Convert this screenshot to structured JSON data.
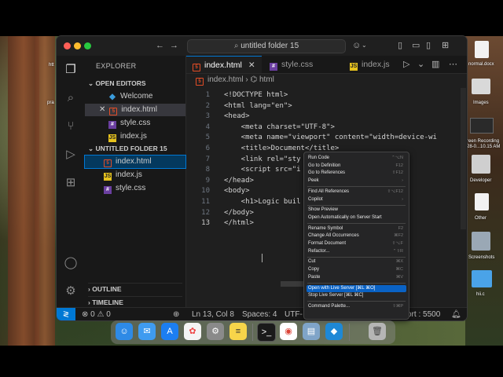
{
  "window": {
    "command_center": "untitled folder 15"
  },
  "sidebar": {
    "title": "EXPLORER",
    "open_editors_label": "OPEN EDITORS",
    "open_editors": [
      {
        "label": "Welcome",
        "icon": "vscode-icon"
      },
      {
        "label": "index.html",
        "icon": "html-file-icon"
      },
      {
        "label": "style.css",
        "icon": "css-file-icon"
      },
      {
        "label": "index.js",
        "icon": "js-file-icon"
      }
    ],
    "folder_label": "UNTITLED FOLDER 15",
    "files": [
      {
        "label": "index.html",
        "icon": "html-file-icon"
      },
      {
        "label": "index.js",
        "icon": "js-file-icon"
      },
      {
        "label": "style.css",
        "icon": "css-file-icon"
      }
    ],
    "outline_label": "OUTLINE",
    "timeline_label": "TIMELINE"
  },
  "tabs": [
    {
      "label": "index.html"
    },
    {
      "label": "style.css"
    },
    {
      "label": "index.js"
    }
  ],
  "breadcrumb": {
    "file": "index.html",
    "node": "html"
  },
  "editor": {
    "current_line": 13,
    "line_numbers": [
      "1",
      "2",
      "3",
      "4",
      "5",
      "6",
      "7",
      "8",
      "9",
      "10",
      "11",
      "12",
      "13"
    ],
    "lines": [
      "<!DOCTYPE html>",
      "<html lang=\"en\">",
      "<head>",
      "    <meta charset=\"UTF-8\">",
      "    <meta name=\"viewport\" content=\"width=device-wi",
      "    <title>Document</title>",
      "    <link rel=\"sty",
      "    <script src=\"i",
      "</head>",
      "<body>",
      "    <h1>Logic buil",
      "</body>",
      "</html>"
    ]
  },
  "context_menu": {
    "items": [
      {
        "label": "Run Code",
        "shortcut": "⌃⌥N"
      },
      {
        "label": "Go to Definition",
        "shortcut": "F12"
      },
      {
        "label": "Go to References",
        "shortcut": "⇧F12"
      },
      {
        "label": "Peek",
        "shortcut": "›"
      },
      {
        "label": "Find All References",
        "shortcut": "⇧⌥F12"
      },
      {
        "label": "Copilot",
        "shortcut": "›"
      },
      {
        "label": "Show Preview",
        "shortcut": ""
      },
      {
        "label": "Open Automatically on Server Start",
        "shortcut": ""
      },
      {
        "label": "Rename Symbol",
        "shortcut": "F2"
      },
      {
        "label": "Change All Occurrences",
        "shortcut": "⌘F2"
      },
      {
        "label": "Format Document",
        "shortcut": "⇧⌥F"
      },
      {
        "label": "Refactor...",
        "shortcut": "⌃⇧R"
      },
      {
        "label": "Cut",
        "shortcut": "⌘X"
      },
      {
        "label": "Copy",
        "shortcut": "⌘C"
      },
      {
        "label": "Paste",
        "shortcut": "⌘V"
      },
      {
        "label": "Open with Live Server [⌘L ⌘O]",
        "shortcut": ""
      },
      {
        "label": "Stop Live Server [⌘L ⌘C]",
        "shortcut": ""
      },
      {
        "label": "Command Palette...",
        "shortcut": "⇧⌘P"
      }
    ]
  },
  "statusbar": {
    "errors": "0",
    "warnings": "0",
    "position": "Ln 13, Col 8",
    "spaces": "Spaces: 4",
    "encoding": "UTF-",
    "port": "ort : 5500"
  },
  "desktop": {
    "labels": [
      "normal.docx",
      "Images",
      "reen Recording",
      "28-0...10.15 AM",
      "Developer",
      "Other",
      "Screenshots",
      "hii.c"
    ],
    "left_labels": [
      "htt",
      "pra"
    ]
  },
  "dock": {
    "apps": [
      "finder-icon",
      "mail-icon",
      "app-store-icon",
      "photos-icon",
      "system-settings-icon",
      "notes-icon",
      "terminal-icon",
      "chrome-icon",
      "preview-icon",
      "vscode-icon",
      "trash-icon"
    ]
  },
  "colors": {
    "accent": "#0078d4",
    "editor_bg": "#1f1f1f",
    "sidebar_bg": "#181818",
    "menu_highlight": "#0a62c4"
  }
}
